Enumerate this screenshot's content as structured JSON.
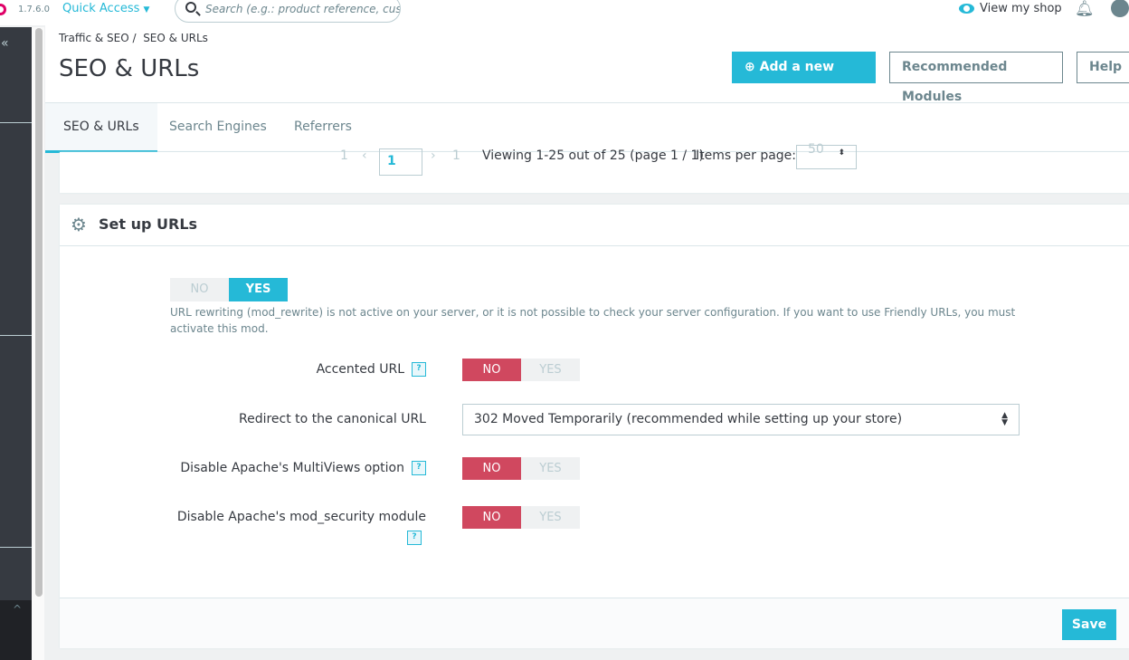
{
  "topbar": {
    "version": "1.7.6.0",
    "quick_access": "Quick Access",
    "search_placeholder": "Search (e.g.: product reference, custome",
    "view_shop": "View my shop"
  },
  "sidebar": {
    "collapse": "«",
    "scroll_up": "^"
  },
  "header": {
    "breadcrumb": [
      "Traffic & SEO",
      "SEO & URLs"
    ],
    "title": "SEO & URLs",
    "buttons": {
      "add": "Add a new page",
      "modules": "Recommended Modules",
      "help": "Help"
    },
    "tabs": [
      {
        "label": "SEO & URLs",
        "active": true
      },
      {
        "label": "Search Engines"
      },
      {
        "label": "Referrers"
      }
    ]
  },
  "pagination": {
    "first": "1",
    "current": "1",
    "last": "1",
    "viewing": "Viewing 1-25 out of 25 (page 1 / 1)",
    "items_per_page_label": "Items per page:",
    "items_per_page": "50"
  },
  "setup": {
    "title": "Set up URLs",
    "friendly": {
      "no": "NO",
      "yes": "YES",
      "value": "YES",
      "description": "URL rewriting (mod_rewrite) is not active on your server, or it is not possible to check your server configuration. If you want to use Friendly URLs, you must activate this mod."
    },
    "fields": [
      {
        "label": "Accented URL",
        "help": "?",
        "no": "NO",
        "yes": "YES",
        "value": "NO"
      },
      {
        "label": "Redirect to the canonical URL",
        "select": "302 Moved Temporarily (recommended while setting up your store)"
      },
      {
        "label": "Disable Apache's MultiViews option",
        "help": "?",
        "no": "NO",
        "yes": "YES",
        "value": "NO"
      },
      {
        "label": "Disable Apache's mod_security module",
        "help": "?",
        "no": "NO",
        "yes": "YES",
        "value": "NO"
      }
    ],
    "save": "Save"
  },
  "colors": {
    "accent": "#25b9d7",
    "danger": "#d0485f",
    "sidebar": "#363a41"
  }
}
